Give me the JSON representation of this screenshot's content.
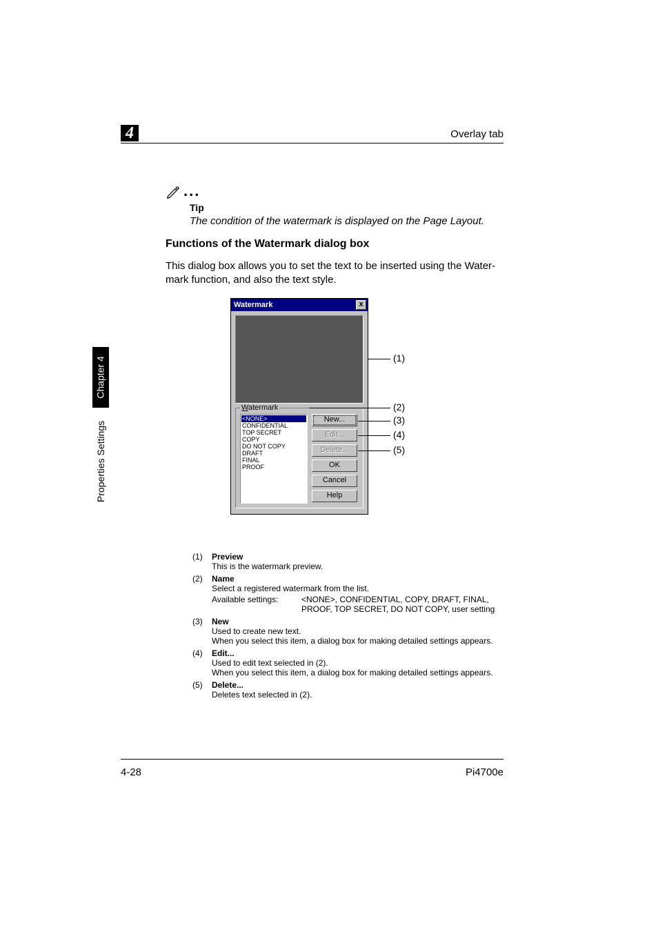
{
  "header": {
    "chapter_num": "4",
    "right": "Overlay tab"
  },
  "tip": {
    "dots": "...",
    "label": "Tip",
    "text": "The condition of the watermark is displayed on the Page Layout."
  },
  "subheading": "Functions of the Watermark dialog box",
  "body": "This dialog box allows you to set the text to be inserted using the Water­mark function, and also the text style.",
  "sidebar": {
    "dark": "Chapter 4",
    "light": "Properties Settings"
  },
  "dialog": {
    "title": "Watermark",
    "close": "x",
    "group_title_pre": "W",
    "group_title_post": "atermark",
    "list": [
      "<NONE>",
      "CONFIDENTIAL",
      "TOP SECRET",
      "COPY",
      "DO NOT COPY",
      "DRAFT",
      "FINAL",
      "PROOF"
    ],
    "buttons": {
      "new": "New...",
      "edit": "Edit...",
      "delete": "Delete...",
      "ok": "OK",
      "cancel": "Cancel",
      "help": "Help"
    }
  },
  "callouts": {
    "c1": "(1)",
    "c2": "(2)",
    "c3": "(3)",
    "c4": "(4)",
    "c5": "(5)"
  },
  "desc": [
    {
      "n": "(1)",
      "title": "Preview",
      "lines": [
        "This is the watermark preview."
      ]
    },
    {
      "n": "(2)",
      "title": "Name",
      "lines": [
        "Select a registered watermark from the list."
      ]
    },
    {
      "n": "(3)",
      "title": "New",
      "lines": [
        "Used to create new text.",
        "When you select this item, a dialog box for making detailed settings appears."
      ]
    },
    {
      "n": "(4)",
      "title": "Edit...",
      "lines": [
        "Used to edit text selected in (2).",
        "When you select this item, a dialog box for making detailed settings appears."
      ]
    },
    {
      "n": "(5)",
      "title": "Delete...",
      "lines": [
        "Deletes text selected in (2)."
      ]
    }
  ],
  "avail": {
    "label": "Available settings:",
    "value": "<NONE>, CONFIDENTIAL, COPY, DRAFT, FINAL, PROOF, TOP SECRET, DO NOT COPY, user setting"
  },
  "chart_data": null,
  "footer": {
    "left": "4-28",
    "right": "Pi4700e"
  }
}
